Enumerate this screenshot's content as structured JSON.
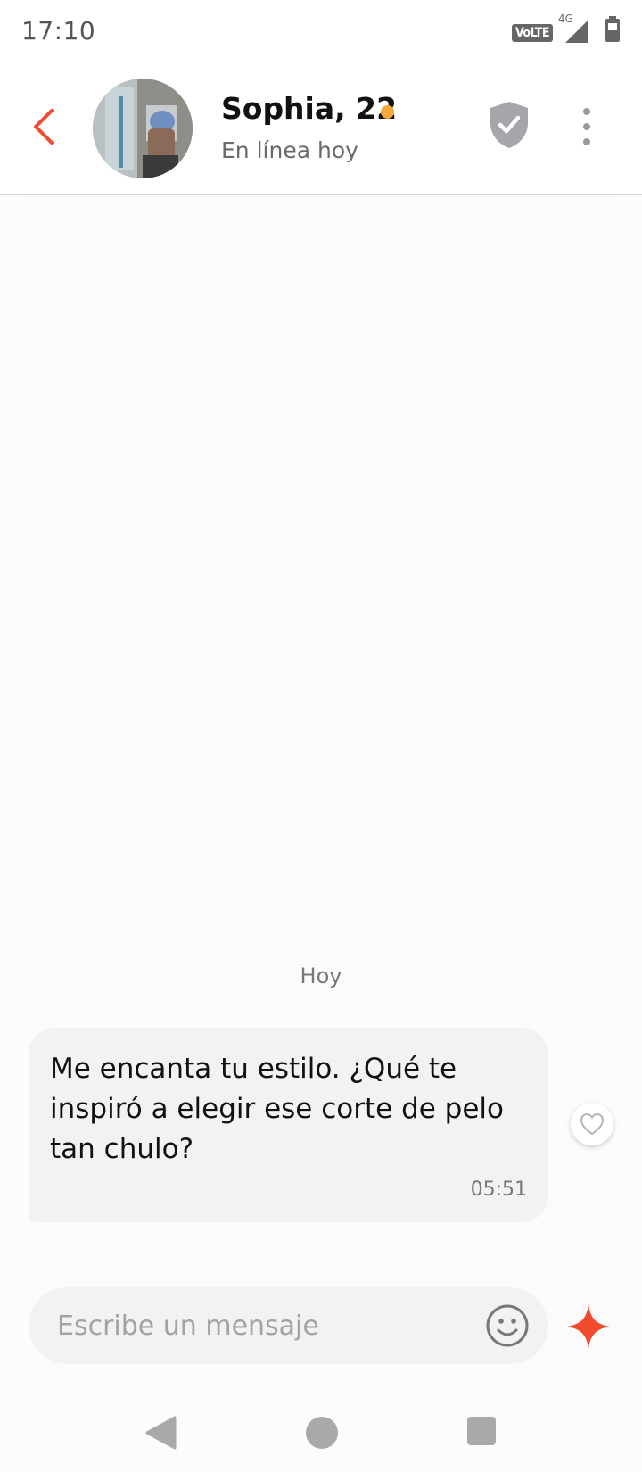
{
  "status_bar": {
    "time": "17:10",
    "volte": "VoLTE",
    "network": "4G",
    "icons": [
      "volte-icon",
      "signal-icon",
      "battery-icon"
    ]
  },
  "header": {
    "name": "Sophia, 22",
    "subtitle": "En línea hoy",
    "online_color": "#f6a83b",
    "icons": [
      "back-arrow-icon",
      "verified-shield-icon",
      "more-vertical-icon"
    ]
  },
  "chat": {
    "day_divider": "Hoy",
    "messages": [
      {
        "text": "Me encanta tu estilo. ¿Qué te inspiró a elegir ese corte de pelo tan chulo?",
        "time": "05:51",
        "reaction_icon": "heart-outline-icon"
      }
    ]
  },
  "composer": {
    "placeholder": "Escribe un mensaje",
    "value": "",
    "icons": [
      "emoji-icon",
      "spark-icon"
    ]
  },
  "colors": {
    "accent": "#f04a2f",
    "bubble": "#f2f1f4",
    "icon_gray": "#a9a9a9"
  }
}
